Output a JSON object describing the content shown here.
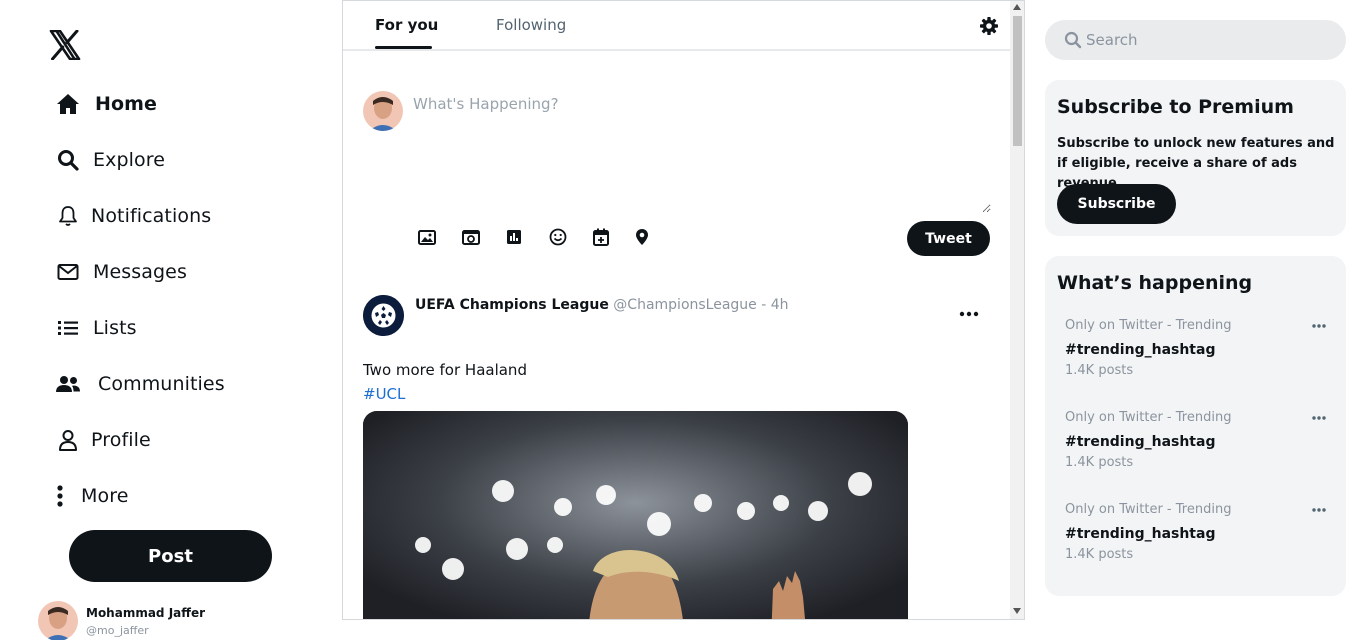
{
  "sidebar": {
    "logo": "x-logo",
    "nav": [
      {
        "label": "Home",
        "icon": "home-icon"
      },
      {
        "label": "Explore",
        "icon": "search-icon"
      },
      {
        "label": "Notifications",
        "icon": "bell-icon"
      },
      {
        "label": "Messages",
        "icon": "envelope-icon"
      },
      {
        "label": "Lists",
        "icon": "list-icon"
      },
      {
        "label": "Communities",
        "icon": "people-icon"
      },
      {
        "label": "Profile",
        "icon": "user-icon"
      },
      {
        "label": "More",
        "icon": "more-vertical-icon"
      }
    ],
    "post_label": "Post",
    "profile": {
      "name": "Mohammad Jaffer",
      "handle": "@mo_jaffer"
    }
  },
  "feed": {
    "tabs": [
      {
        "label": "For you",
        "active": true
      },
      {
        "label": "Following",
        "active": false
      }
    ],
    "composer": {
      "placeholder": "What's Happening?",
      "tools": [
        "image-icon",
        "gif-icon",
        "poll-icon",
        "emoji-icon",
        "schedule-icon",
        "location-icon"
      ],
      "tweet_label": "Tweet"
    },
    "post": {
      "author": "UEFA Champions League",
      "handle": "@ChampionsLeague",
      "separator": " - ",
      "time": "4h",
      "text": "Two more for Haaland",
      "hashtag": "#UCL"
    }
  },
  "right": {
    "search_placeholder": "Search",
    "premium": {
      "title": "Subscribe to Premium",
      "body": "Subscribe to unlock new features and if eligible, receive a share of ads revenue.",
      "button": "Subscribe"
    },
    "happening": {
      "title": "What’s happening",
      "trends": [
        {
          "category": "Only on Twitter - Trending",
          "tag": "#trending_hashtag",
          "count": "1.4K posts"
        },
        {
          "category": "Only on Twitter - Trending",
          "tag": "#trending_hashtag",
          "count": "1.4K posts"
        },
        {
          "category": "Only on Twitter - Trending",
          "tag": "#trending_hashtag",
          "count": "1.4K posts"
        }
      ]
    }
  },
  "colors": {
    "accent": "#0f1419",
    "link": "#1d6fd1",
    "muted": "#8b949e",
    "card_bg": "#f3f4f6"
  }
}
